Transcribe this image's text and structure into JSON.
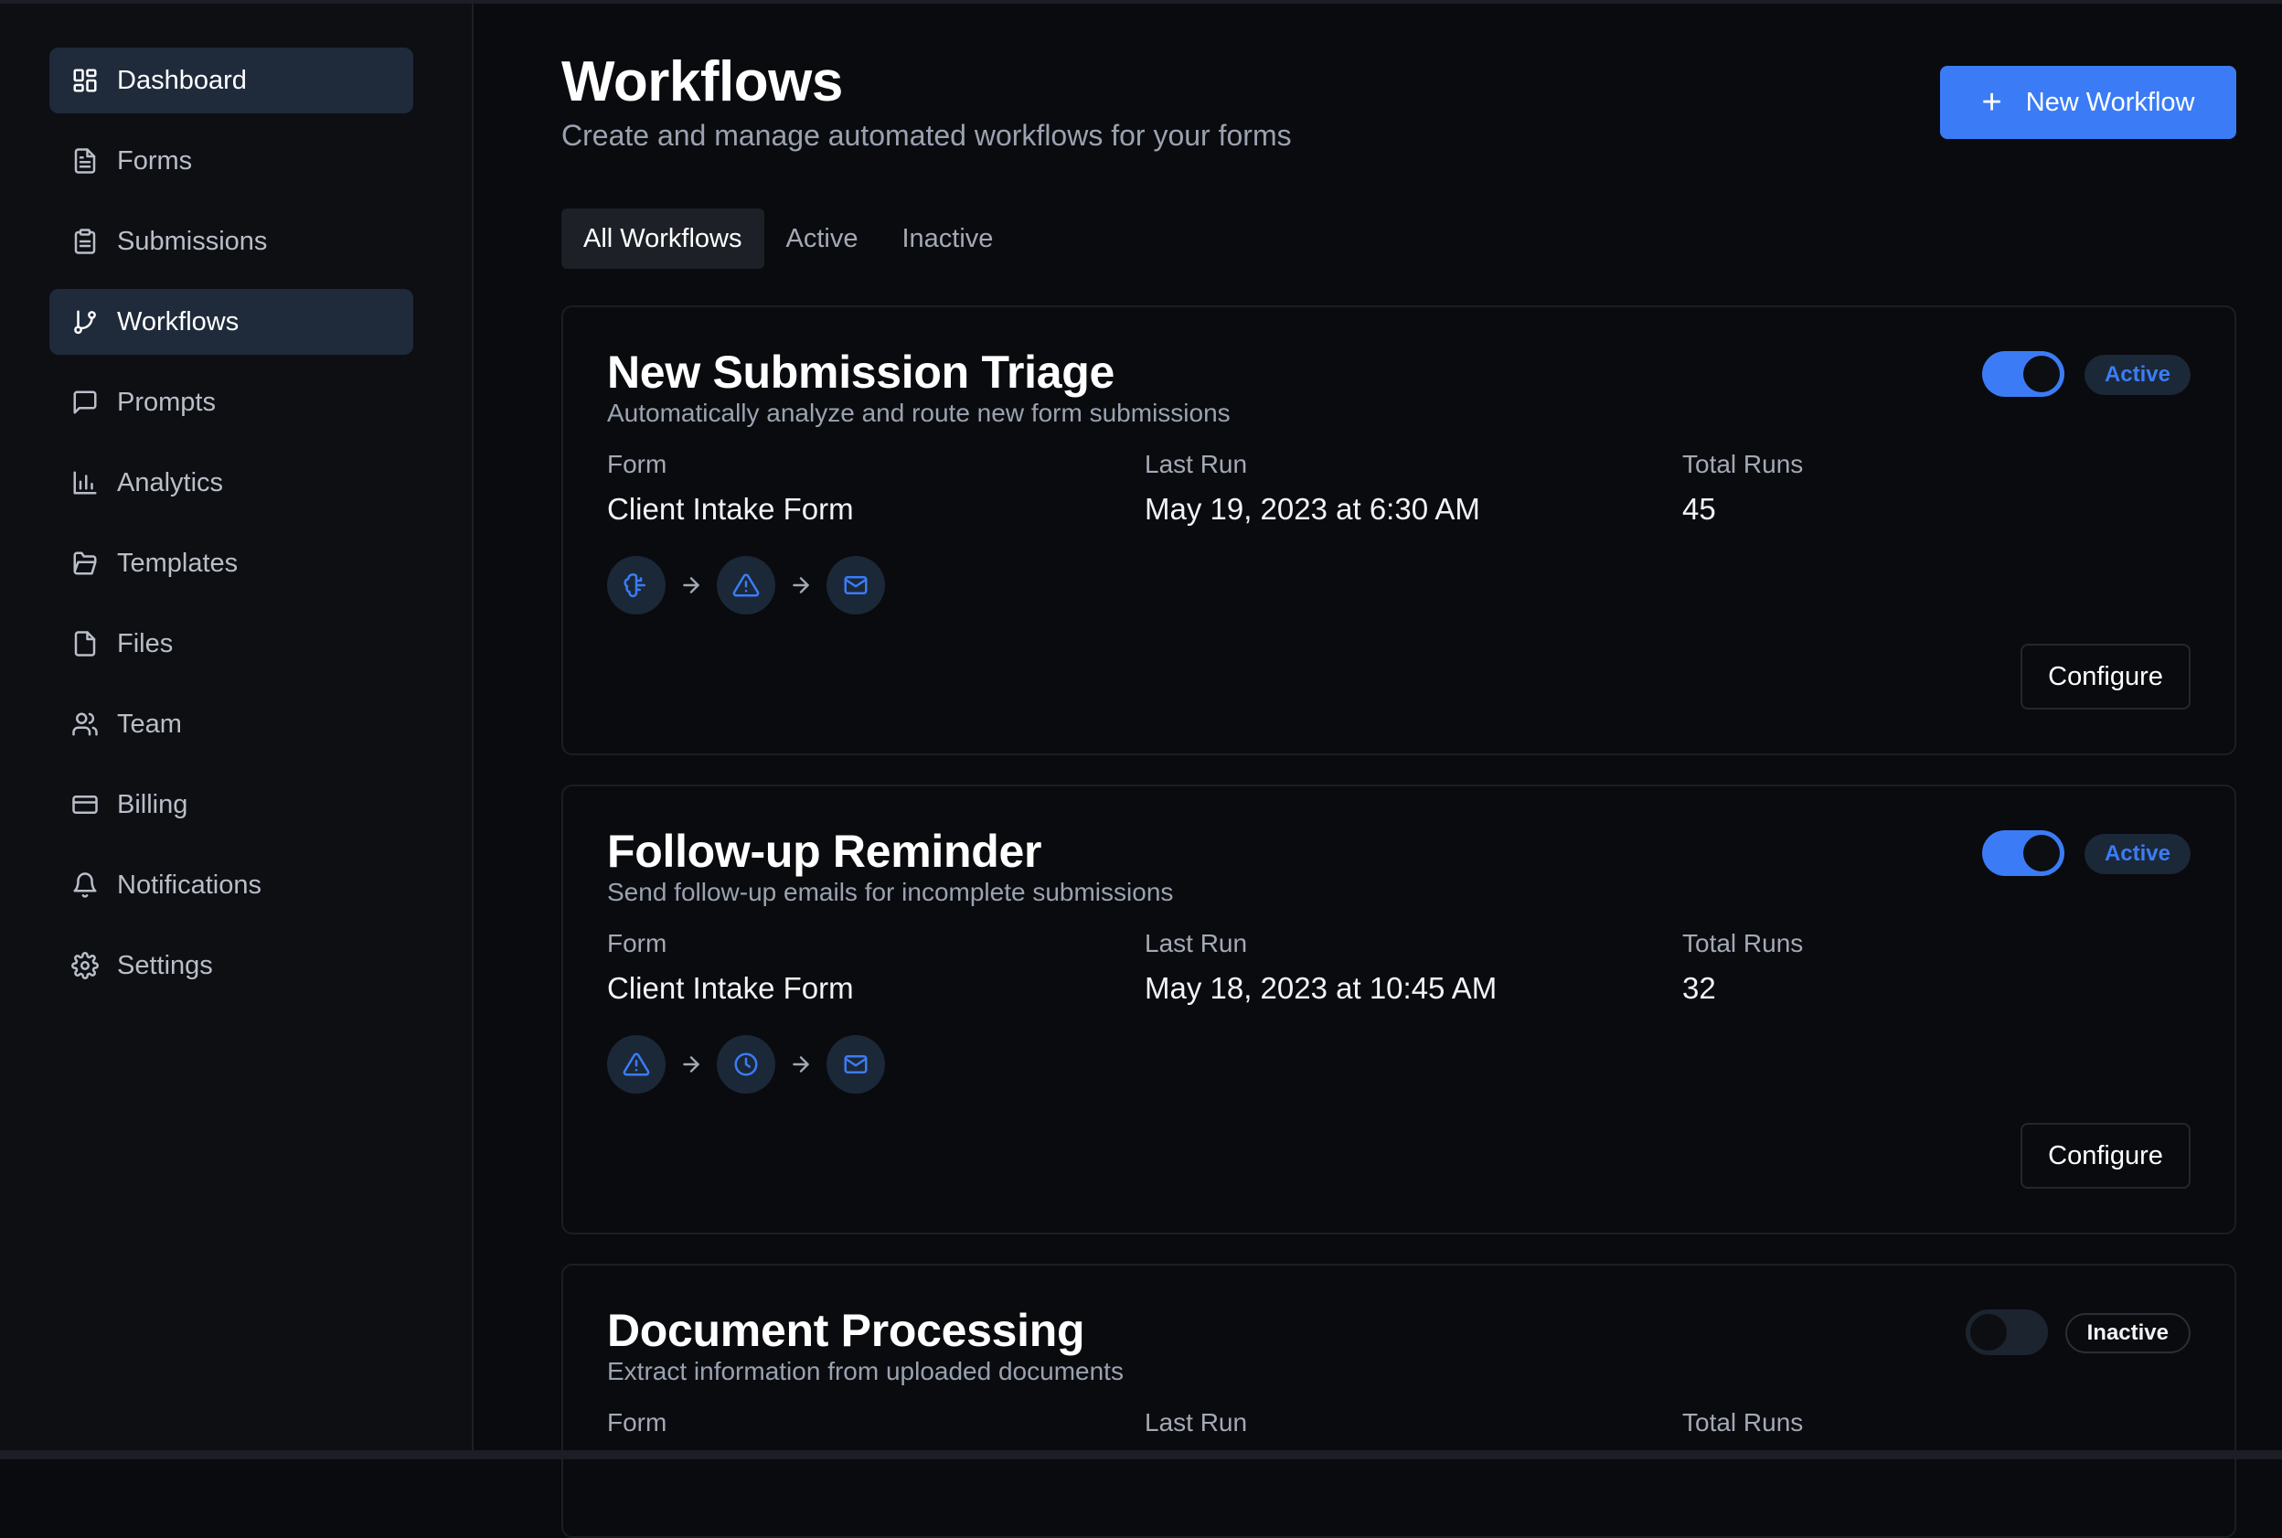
{
  "sidebar": {
    "items": [
      {
        "label": "Dashboard",
        "icon": "dashboard-icon",
        "active": true
      },
      {
        "label": "Forms",
        "icon": "document-icon",
        "active": false
      },
      {
        "label": "Submissions",
        "icon": "clipboard-icon",
        "active": false
      },
      {
        "label": "Workflows",
        "icon": "git-branch-icon",
        "active": true
      },
      {
        "label": "Prompts",
        "icon": "message-square-icon",
        "active": false
      },
      {
        "label": "Analytics",
        "icon": "bar-chart-icon",
        "active": false
      },
      {
        "label": "Templates",
        "icon": "folder-open-icon",
        "active": false
      },
      {
        "label": "Files",
        "icon": "file-icon",
        "active": false
      },
      {
        "label": "Team",
        "icon": "users-icon",
        "active": false
      },
      {
        "label": "Billing",
        "icon": "credit-card-icon",
        "active": false
      },
      {
        "label": "Notifications",
        "icon": "bell-icon",
        "active": false
      },
      {
        "label": "Settings",
        "icon": "gear-icon",
        "active": false
      }
    ]
  },
  "header": {
    "title": "Workflows",
    "subtitle": "Create and manage automated workflows for your forms",
    "new_button_icon": "plus-icon",
    "new_button_label": "New Workflow"
  },
  "tabs": [
    {
      "label": "All Workflows",
      "active": true
    },
    {
      "label": "Active",
      "active": false
    },
    {
      "label": "Inactive",
      "active": false
    }
  ],
  "labels": {
    "form": "Form",
    "last_run": "Last Run",
    "total_runs": "Total Runs",
    "configure": "Configure"
  },
  "workflows": [
    {
      "title": "New Submission Triage",
      "description": "Automatically analyze and route new form submissions",
      "enabled": true,
      "status": "Active",
      "form": "Client Intake Form",
      "last_run": "May 19, 2023 at 6:30 AM",
      "total_runs": "45",
      "steps": [
        "brain-icon",
        "alert-triangle-icon",
        "mail-icon"
      ]
    },
    {
      "title": "Follow-up Reminder",
      "description": "Send follow-up emails for incomplete submissions",
      "enabled": true,
      "status": "Active",
      "form": "Client Intake Form",
      "last_run": "May 18, 2023 at 10:45 AM",
      "total_runs": "32",
      "steps": [
        "alert-triangle-icon",
        "clock-icon",
        "mail-icon"
      ]
    },
    {
      "title": "Document Processing",
      "description": "Extract information from uploaded documents",
      "enabled": false,
      "status": "Inactive"
    }
  ],
  "colors": {
    "accent": "#3b7cf6",
    "background": "#0a0b0e",
    "sidebar_active": "#1f2a3b"
  }
}
